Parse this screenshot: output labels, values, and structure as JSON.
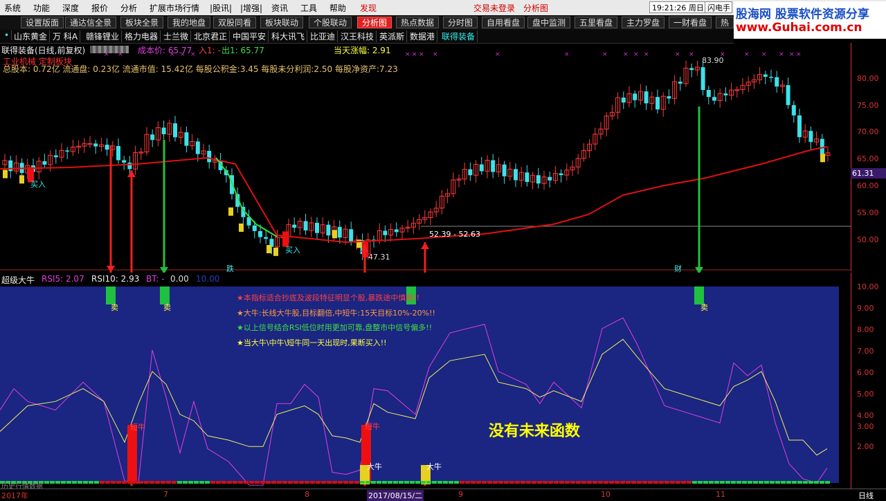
{
  "menu": {
    "items": [
      "系统",
      "功能",
      "深度",
      "报价",
      "分析",
      "扩展市场行情",
      "|股讯|",
      "|增强|",
      "资讯",
      "工具",
      "帮助",
      "发现"
    ],
    "center_left": "交易未登录",
    "center_right": "分析图",
    "clock": "19:21:26 周日",
    "flash": "闪电手"
  },
  "logo": {
    "line1": "股海网 股票软件资源分享",
    "line2": "www.Guhai.com.cn"
  },
  "tabs": [
    "设置版面",
    "通达信全景",
    "板块全景",
    "我的地盘",
    "双股同看",
    "板块联动",
    "个股联动",
    "分析图",
    "热点数据",
    "分时图",
    "自用看盘",
    "盘中监测",
    "五里看盘",
    "主力罗盘",
    "一财看盘",
    "热"
  ],
  "active_tab": "分析图",
  "stocks": [
    "山东黄金",
    "万 科A",
    "赣锋锂业",
    "格力电器",
    "士兰微",
    "北京君正",
    "中国平安",
    "科大讯飞",
    "比亚迪",
    "汉王科技",
    "英派斯",
    "数据港",
    "联得装备"
  ],
  "selected_stock": "联得装备",
  "info": {
    "title": "联得装备(日线,前复权)",
    "cost": "成本价: 65.77",
    "in1": "入1: -",
    "out1": "出1: 65.77",
    "today_change": "当天涨幅: 2.91",
    "sector": "工业机械 定制板块",
    "fundamentals": "总股本: 0.72亿 流通盘: 0.23亿 流通市值: 15.42亿 每股公积金:3.45 每股未分利润:2.50 每股净资产:7.23"
  },
  "main_chart": {
    "y_ticks": [
      "80.00",
      "75.00",
      "70.00",
      "65.00",
      "60.00",
      "55.00",
      "50.00"
    ],
    "current_price": "61.31",
    "high_label": "83.90",
    "low_label": "47.31",
    "range_label": "52.39 - 52.63",
    "buy_labels": [
      "买入",
      "买入"
    ],
    "marker_die": "跌",
    "marker_cai": "财"
  },
  "sub_chart": {
    "title": "超级大牛",
    "rsi5": "RSI5: 2.07",
    "rsi10": "RSI10: 2.93",
    "bt": "BT: -",
    "bt_value": "0.00",
    "level": "10.00",
    "y_ticks": [
      "10.00",
      "9.00",
      "8.00",
      "7.00",
      "6.00",
      "5.00",
      "4.00",
      "3.00",
      "2.00"
    ],
    "notes": [
      "★本指标适合抄底及波段特征明显个股,暴跌途中慎用!!",
      "★大牛:长线大牛股,目标翻倍,中短牛:15天目标10%-20%!!",
      "★以上信号结合RSI低位时用更加可靠,盘整市中信号偏多!!",
      "★当大牛\\中牛\\短牛同一天出现时,果断买入!!"
    ],
    "sell_label": "卖",
    "short_bull": "短牛",
    "big_bull": "大牛",
    "annotation": "没有未来函数",
    "footer_label": "历史行情数据"
  },
  "date_axis": {
    "labels": [
      "2017年",
      "7",
      "8",
      "2017/08/15/二",
      "9",
      "10",
      "11"
    ],
    "period": "日线"
  },
  "colors": {
    "up": "#ff3b3b",
    "down": "#3ee0e8",
    "ma": "#e01010",
    "panel": "#1b2582"
  }
}
